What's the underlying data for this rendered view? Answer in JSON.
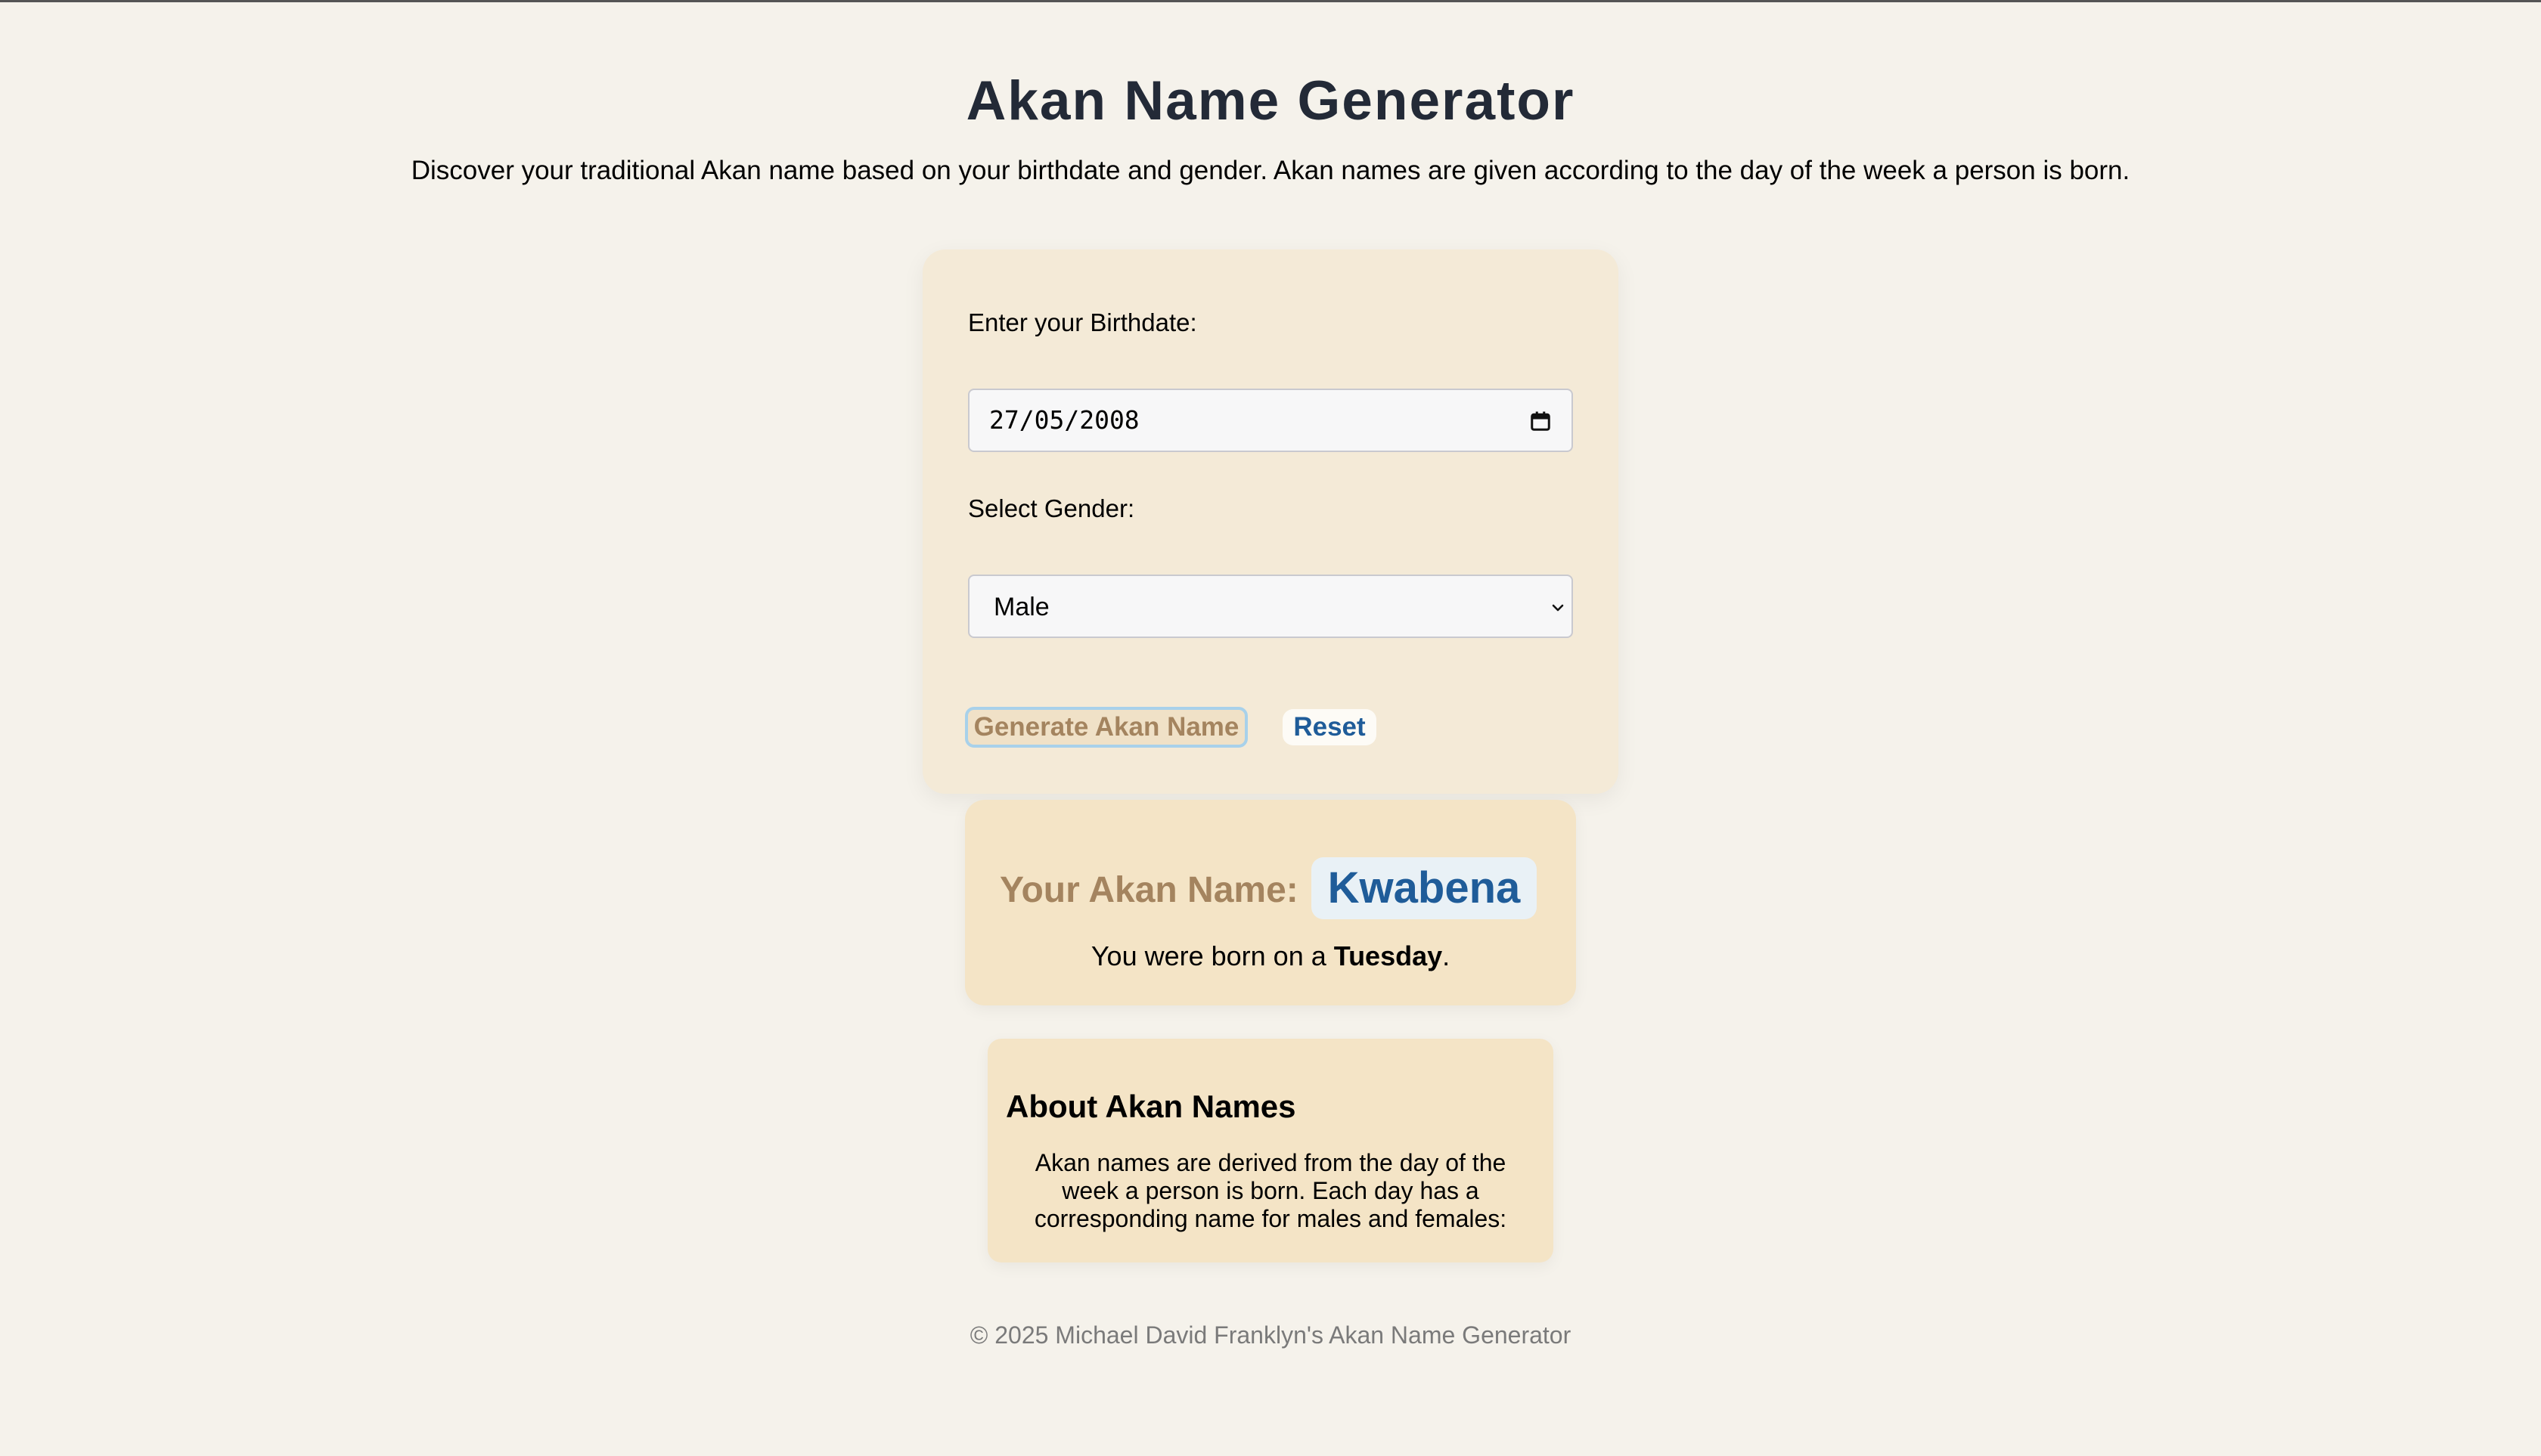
{
  "header": {
    "title": "Akan Name Generator",
    "intro": "Discover your traditional Akan name based on your birthdate and gender. Akan names are given according to the day of the week a person is born."
  },
  "form": {
    "birthdate_label": "Enter your Birthdate:",
    "birthdate_value": "27/05/2008",
    "gender_label": "Select Gender:",
    "gender_value": "Male",
    "generate_label": "Generate Akan Name",
    "reset_label": "Reset"
  },
  "result": {
    "heading": "Your Akan Name:",
    "name": "Kwabena",
    "born_prefix": "You were born on a ",
    "day": "Tuesday",
    "born_suffix": "."
  },
  "about": {
    "heading": "About Akan Names",
    "text": "Akan names are derived from the day of the week a person is born. Each day has a corresponding name for males and females:"
  },
  "footer": {
    "text": "© 2025 Michael David Franklyn's Akan Name Generator"
  },
  "icons": {
    "date_picker": "calendar-icon",
    "select_arrow": "chevron-down-icon"
  },
  "colors": {
    "background": "#f5f2eb",
    "card": "#f4ead7",
    "accent_brown": "#a4845f",
    "accent_blue": "#1f5c99",
    "title": "#232a37"
  }
}
